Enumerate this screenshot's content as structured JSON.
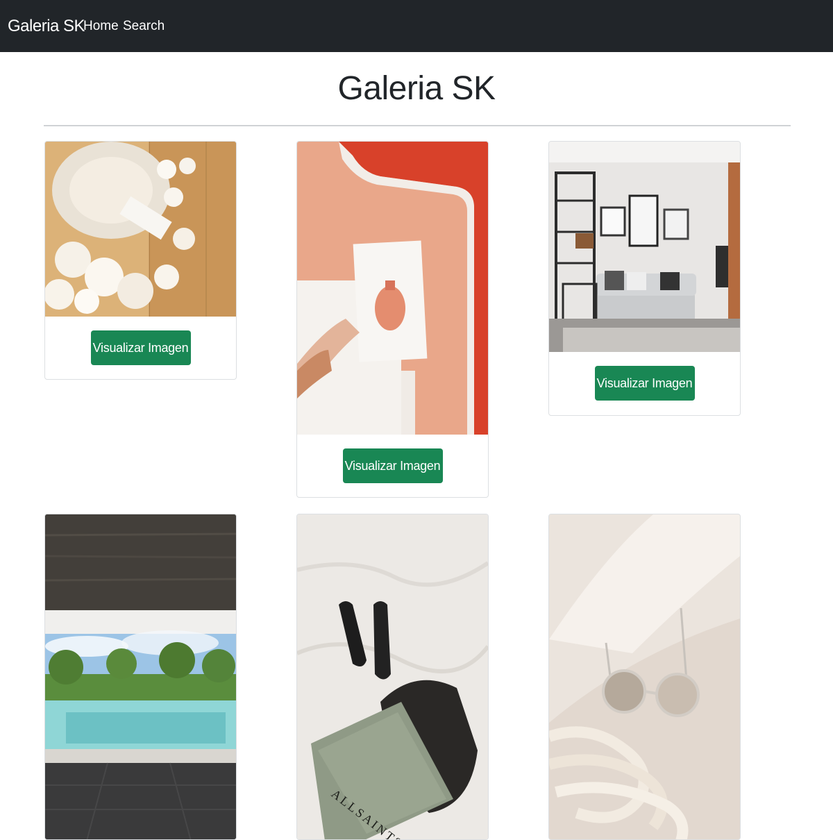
{
  "navbar": {
    "brand": "Galeria SK",
    "links": [
      "Home",
      "Search"
    ]
  },
  "page": {
    "title": "Galeria SK"
  },
  "cards": [
    {
      "photo": "candle-and-petals",
      "button": "Visualizar Imagen"
    },
    {
      "photo": "hand-holding-card-brick-wall",
      "button": "Visualizar Imagen"
    },
    {
      "photo": "living-room-sofa",
      "button": "Visualizar Imagen"
    },
    {
      "photo": "pool-with-palms"
    },
    {
      "photo": "shoes-and-shopping-bag"
    },
    {
      "photo": "sunglasses-and-rope"
    }
  ],
  "colors": {
    "navbar_bg": "#212529",
    "button_bg": "#198754",
    "title_text": "#212529"
  },
  "bag_text": "ALLSAINTS"
}
